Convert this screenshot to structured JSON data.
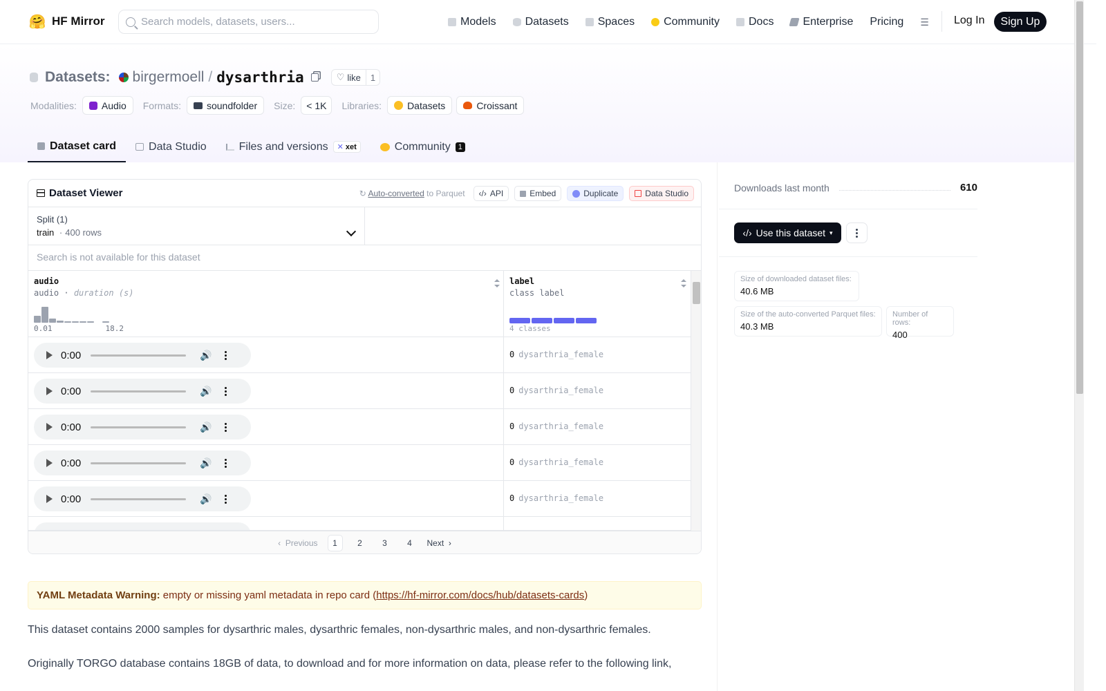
{
  "nav": {
    "brand": "HF Mirror",
    "search_placeholder": "Search models, datasets, users...",
    "links": [
      "Models",
      "Datasets",
      "Spaces",
      "Community",
      "Docs",
      "Enterprise",
      "Pricing"
    ],
    "login": "Log In",
    "signup": "Sign Up"
  },
  "header": {
    "section": "Datasets:",
    "owner": "birgermoell",
    "separator": "/",
    "name": "dysarthria",
    "like_label": "like",
    "like_count": "1",
    "tags": {
      "modalities_label": "Modalities:",
      "modality": "Audio",
      "formats_label": "Formats:",
      "format": "soundfolder",
      "size_label": "Size:",
      "size": "< 1K",
      "libraries_label": "Libraries:",
      "libraries": [
        "Datasets",
        "Croissant"
      ]
    },
    "tabs": {
      "card": "Dataset card",
      "studio": "Data Studio",
      "files": "Files and versions",
      "xet": "xet",
      "community": "Community",
      "community_count": "1"
    }
  },
  "viewer": {
    "title": "Dataset Viewer",
    "auto_link": "Auto-converted",
    "auto_rest": " to Parquet",
    "actions": [
      "API",
      "Embed",
      "Duplicate",
      "Data Studio"
    ],
    "split_label": "Split (1)",
    "split_name": "train",
    "split_dot": "·",
    "split_rows": "400 rows",
    "search_disabled": "Search is not available for this dataset",
    "columns": {
      "audio": {
        "name": "audio",
        "type": "audio",
        "sub": "duration (s)",
        "min": "0.01",
        "max": "18.2",
        "hist": [
          0.4,
          0.9,
          0.22,
          0.1,
          0.06,
          0.06,
          0.06,
          0.06,
          0.0,
          0.06
        ]
      },
      "label": {
        "name": "label",
        "type": "class label",
        "classes": "4 classes"
      }
    },
    "rows": [
      {
        "time": "0:00",
        "label_id": "0",
        "label": "dysarthria_female"
      },
      {
        "time": "0:00",
        "label_id": "0",
        "label": "dysarthria_female"
      },
      {
        "time": "0:00",
        "label_id": "0",
        "label": "dysarthria_female"
      },
      {
        "time": "0:00",
        "label_id": "0",
        "label": "dysarthria_female"
      },
      {
        "time": "0:00",
        "label_id": "0",
        "label": "dysarthria_female"
      }
    ],
    "pager": {
      "prev": "Previous",
      "pages": [
        "1",
        "2",
        "3",
        "4"
      ],
      "next": "Next"
    }
  },
  "warning": {
    "bold": "YAML Metadata Warning:",
    "text": " empty or missing yaml metadata in repo card (",
    "link": "https://hf-mirror.com/docs/hub/datasets-cards",
    "close": ")"
  },
  "content": {
    "p1": "This dataset contains 2000 samples for dysarthric males, dysarthric females, non-dysarthric males, and non-dysarthric females.",
    "p2": "Originally TORGO database contains 18GB of data, to download and for more information on data, please refer to the following link,"
  },
  "sidebar": {
    "downloads_label": "Downloads last month",
    "downloads_value": "610",
    "use_button": "Use this dataset",
    "stats": [
      {
        "label": "Size of downloaded dataset files:",
        "value": "40.6 MB"
      },
      {
        "label": "Size of the auto-converted Parquet files:",
        "value": "40.3 MB"
      },
      {
        "label": "Number of rows:",
        "value": "400"
      }
    ]
  },
  "colors": {
    "accent": "#6366f1",
    "dark": "#0b0f19",
    "warning_bg": "#fefce8"
  }
}
